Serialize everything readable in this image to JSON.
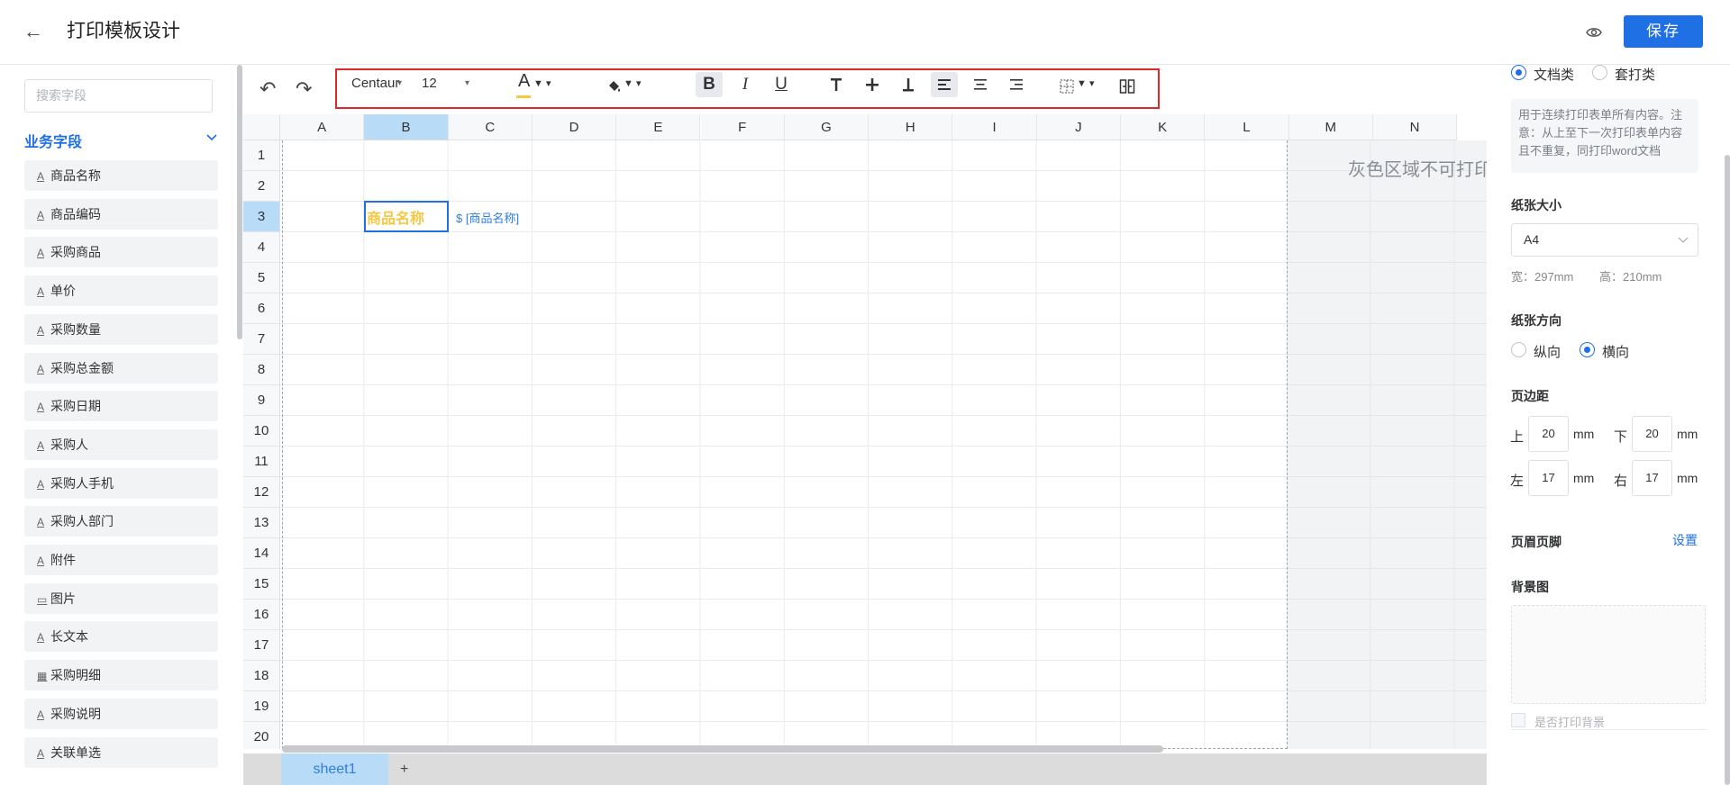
{
  "header": {
    "back_label": "←",
    "title": "打印模板设计",
    "save_label": "保存"
  },
  "left": {
    "search_placeholder": "搜索字段",
    "group_title": "业务字段",
    "fields": [
      {
        "icon": "A",
        "label": "商品名称"
      },
      {
        "icon": "A",
        "label": "商品编码"
      },
      {
        "icon": "A",
        "label": "采购商品"
      },
      {
        "icon": "A",
        "label": "单价"
      },
      {
        "icon": "A",
        "label": "采购数量"
      },
      {
        "icon": "A",
        "label": "采购总金额"
      },
      {
        "icon": "A",
        "label": "采购日期"
      },
      {
        "icon": "A",
        "label": "采购人"
      },
      {
        "icon": "A",
        "label": "采购人手机"
      },
      {
        "icon": "A",
        "label": "采购人部门"
      },
      {
        "icon": "A",
        "label": "附件"
      },
      {
        "icon": "▭",
        "label": "图片"
      },
      {
        "icon": "A",
        "label": "长文本"
      },
      {
        "icon": "▦",
        "label": "采购明细"
      },
      {
        "icon": "A",
        "label": "采购说明"
      },
      {
        "icon": "A",
        "label": "关联单选"
      }
    ]
  },
  "toolbar": {
    "undo": "↶",
    "redo": "↷",
    "font": "Centaur",
    "font_size": "12",
    "bold": "B",
    "italic": "I",
    "underline": "U",
    "font_color_glyph": "A"
  },
  "sheet": {
    "columns": [
      "A",
      "B",
      "C",
      "D",
      "E",
      "F",
      "G",
      "H",
      "I",
      "J",
      "K",
      "L",
      "M",
      "N"
    ],
    "rows": [
      "1",
      "2",
      "3",
      "4",
      "5",
      "6",
      "7",
      "8",
      "9",
      "10",
      "11",
      "12",
      "13",
      "14",
      "15",
      "16",
      "17",
      "18",
      "19",
      "20"
    ],
    "selected_column": "B",
    "selected_row": "3",
    "cell_b3": "商品名称",
    "cell_c3": "$ [商品名称]",
    "grey_area_text": "灰色区域不可打印",
    "tab_name": "sheet1",
    "add_tab": "+"
  },
  "right": {
    "doc_type": "文档类",
    "overlay_type": "套打类",
    "doc_note": "用于连续打印表单所有内容。注意：从上至下一次打印表单内容且不重复，同打印word文档",
    "paper_size_label": "纸张大小",
    "paper_size": "A4",
    "width_text": "宽：297mm",
    "height_text": "高：210mm",
    "orientation_label": "纸张方向",
    "portrait": "纵向",
    "landscape": "横向",
    "margin_label": "页边距",
    "top_label": "上",
    "top_value": "20",
    "bottom_label": "下",
    "bottom_value": "20",
    "left_label": "左",
    "left_value": "17",
    "right_label": "右",
    "right_value": "17",
    "unit": "mm",
    "header_footer_label": "页眉页脚",
    "header_footer_action": "设置",
    "bg_label": "背景图",
    "print_bg_label": "是否打印背景",
    "accent_color": "#1f6fe5"
  }
}
